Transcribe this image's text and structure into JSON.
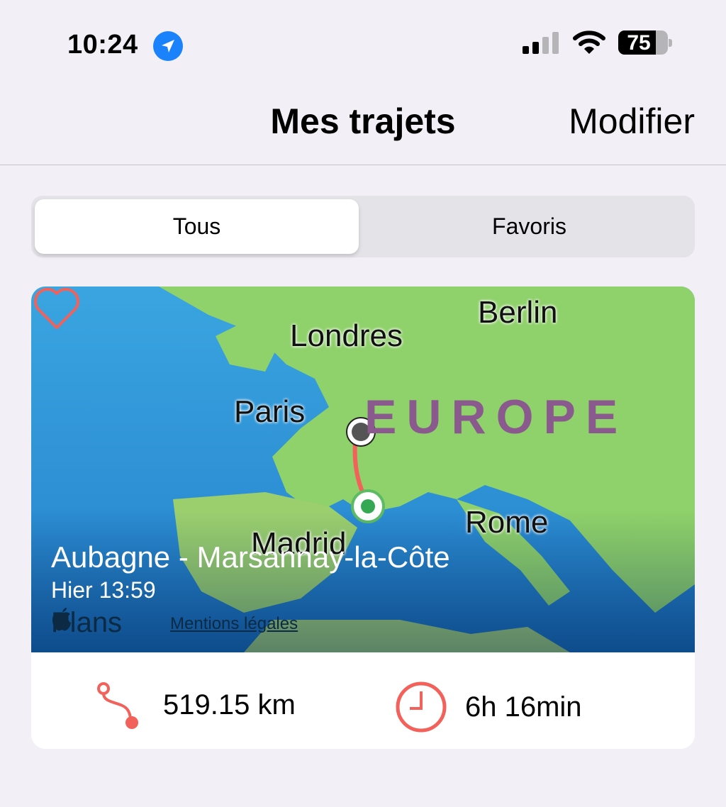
{
  "status_bar": {
    "time": "10:24",
    "battery": "75",
    "battery_level_percent": 75,
    "signal_bars": 2,
    "icons": [
      "location-arrow-icon",
      "cellular-signal-icon",
      "wifi-icon",
      "battery-icon"
    ]
  },
  "nav": {
    "title": "Mes trajets",
    "edit_label": "Modifier"
  },
  "segments": {
    "all": "Tous",
    "favorites": "Favoris",
    "selected": "Tous"
  },
  "trip": {
    "map_labels": {
      "london": "Londres",
      "berlin": "Berlin",
      "paris": "Paris",
      "europe": "EUROPE",
      "rome": "Rome",
      "madrid": "Madrid"
    },
    "title": "Aubagne - Marsannay-la-Côte",
    "date": "Hier 13:59",
    "maps_brand": "Plans",
    "legal_link": "Mentions légales",
    "distance": "519.15 km",
    "duration": "6h 16min",
    "favorite": false,
    "accent_color": "#f2615a"
  }
}
